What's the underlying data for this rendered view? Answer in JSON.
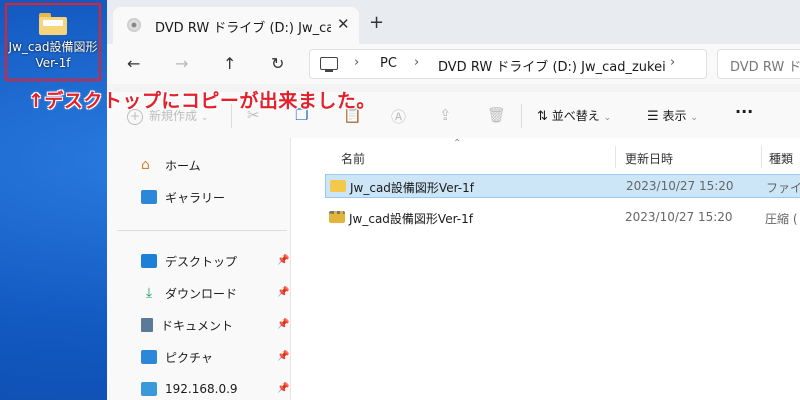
{
  "desktop": {
    "icon_label_line1": "Jw_cad設備図形",
    "icon_label_line2": "Ver-1f",
    "annotation": "↑デスクトップにコピーが出来ました。"
  },
  "explorer": {
    "tab_title": "DVD RW ドライブ (D:) Jw_cad_zu",
    "tab_close": "✕",
    "new_tab": "+",
    "nav": {
      "back": "←",
      "forward": "→",
      "up": "↑",
      "refresh": "↻"
    },
    "breadcrumb": {
      "pc": "PC",
      "drive": "DVD RW ドライブ (D:) Jw_cad_zukei"
    },
    "search_placeholder": "DVD RW ドラ",
    "toolbar": {
      "new_label": "新規作成",
      "sort_label": "並べ替え",
      "view_label": "表示",
      "more": "···"
    },
    "sidebar": {
      "items": [
        {
          "label": "ホーム"
        },
        {
          "label": "ギャラリー"
        },
        {
          "label": "デスクトップ"
        },
        {
          "label": "ダウンロード"
        },
        {
          "label": "ドキュメント"
        },
        {
          "label": "ピクチャ"
        },
        {
          "label": "192.168.0.9"
        }
      ]
    },
    "columns": {
      "name": "名前",
      "date": "更新日時",
      "type": "種類"
    },
    "files": [
      {
        "name": "Jw_cad設備図形Ver-1f",
        "date": "2023/10/27 15:20",
        "type": "ファイル"
      },
      {
        "name": "Jw_cad設備図形Ver-1f",
        "date": "2023/10/27 15:20",
        "type": "圧縮 ("
      }
    ]
  },
  "colors": {
    "annotation": "#e4202b",
    "selection": "#cde6f7",
    "desktop": "#1565c8"
  }
}
